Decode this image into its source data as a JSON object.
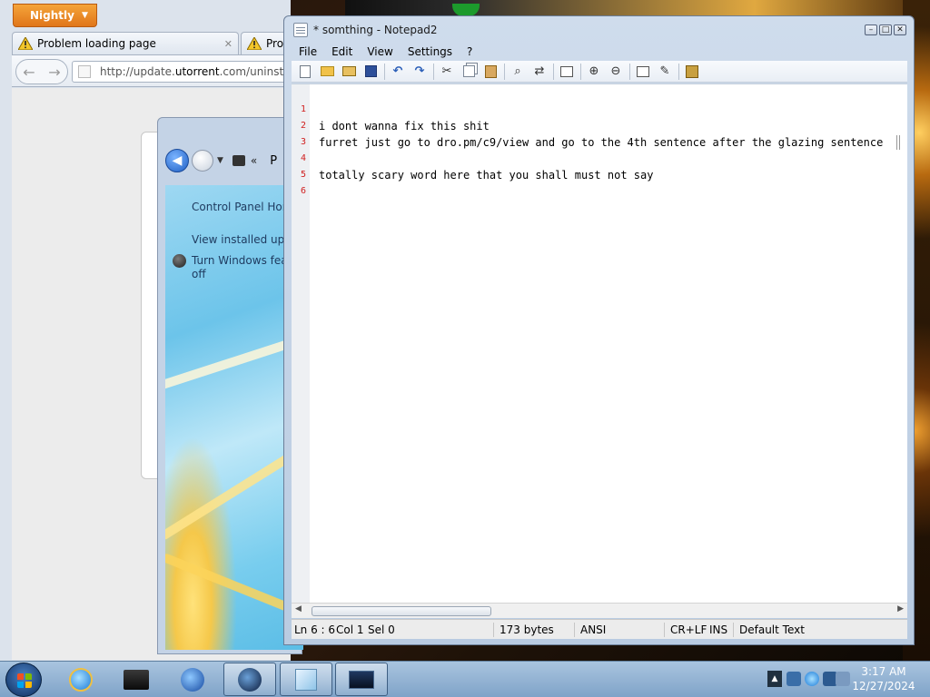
{
  "browser": {
    "menu_button": "Nightly",
    "tabs": [
      {
        "label": "Problem loading page"
      },
      {
        "label": "Prob"
      }
    ],
    "url_scheme": "http://update.",
    "url_host": "utorrent",
    "url_rest": ".com/uninstall?"
  },
  "control_panel": {
    "breadcrumb_overflow": "«",
    "breadcrumb_partial": "P",
    "sidebar": [
      {
        "label": "Control Panel Hom"
      },
      {
        "label": "View installed upda"
      },
      {
        "label": "Turn Windows feat"
      },
      {
        "label": "off"
      }
    ]
  },
  "notepad": {
    "title": "* somthing - Notepad2",
    "menu": [
      "File",
      "Edit",
      "View",
      "Settings",
      "?"
    ],
    "toolbar_icons": [
      "new-icon",
      "open-icon",
      "browse-icon",
      "save-icon",
      "undo-icon",
      "redo-icon",
      "cut-icon",
      "copy-icon",
      "paste-icon",
      "find-icon",
      "replace-icon",
      "word-wrap-icon",
      "zoom-in-icon",
      "zoom-out-icon",
      "scheme-icon",
      "customize-scheme-icon",
      "exit-icon"
    ],
    "lines": [
      {
        "num": "1",
        "text": "i dont wanna fix this shit"
      },
      {
        "num": "2",
        "text": "furret just go to dro.pm/c9/view and go to the 4th sentence after the glazing sentence"
      },
      {
        "num": "3",
        "text": ""
      },
      {
        "num": "4",
        "text": "totally scary word here that you shall must not say"
      },
      {
        "num": "5",
        "text": ""
      },
      {
        "num": "6",
        "text": ""
      }
    ],
    "status": {
      "position": "Ln 6 : 6",
      "col": "Col 1",
      "sel": "Sel 0",
      "size": "173 bytes",
      "encoding": "ANSI",
      "eol": "CR+LF",
      "mode": "INS",
      "scheme": "Default Text"
    }
  },
  "taskbar": {
    "apps": [
      "internet-explorer-icon",
      "black-window-icon",
      "media-player-icon",
      "globe-icon",
      "notepad2-icon",
      "monitor-icon"
    ],
    "clock_time": "3:17 AM",
    "clock_date": "12/27/2024"
  },
  "colors": {
    "line_number": "#d02020",
    "nightly_orange": "#e0761a"
  }
}
